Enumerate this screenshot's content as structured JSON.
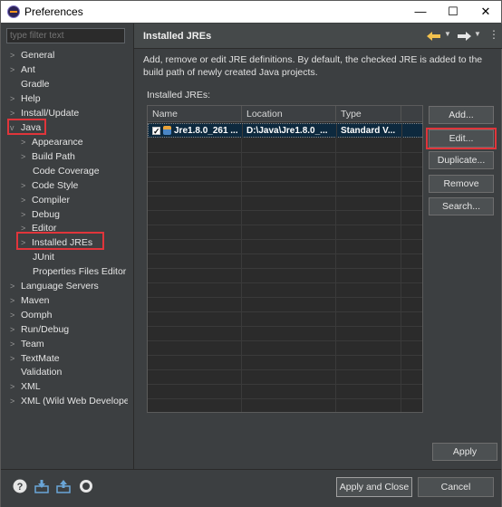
{
  "window": {
    "title": "Preferences",
    "minimize": "—",
    "maximize": "☐",
    "close": "✕"
  },
  "filter": {
    "placeholder": "type filter text"
  },
  "tree": {
    "general": "General",
    "ant": "Ant",
    "gradle": "Gradle",
    "help": "Help",
    "install_update": "Install/Update",
    "java": "Java",
    "appearance": "Appearance",
    "build_path": "Build Path",
    "code_coverage": "Code Coverage",
    "code_style": "Code Style",
    "compiler": "Compiler",
    "debug": "Debug",
    "editor": "Editor",
    "installed_jres": "Installed JREs",
    "junit": "JUnit",
    "properties_files_editor": "Properties Files Editor",
    "language_servers": "Language Servers",
    "maven": "Maven",
    "oomph": "Oomph",
    "run_debug": "Run/Debug",
    "team": "Team",
    "textmate": "TextMate",
    "validation": "Validation",
    "xml": "XML",
    "xml_wild": "XML (Wild Web Develope"
  },
  "page": {
    "title": "Installed JREs",
    "description": "Add, remove or edit JRE definitions. By default, the checked JRE is added to the build path of newly created Java projects.",
    "jres_label": "Installed JREs:"
  },
  "table": {
    "columns": {
      "name": "Name",
      "location": "Location",
      "type": "Type"
    },
    "rows": [
      {
        "checked": true,
        "name": "Jre1.8.0_261 ...",
        "location": "D:\\Java\\Jre1.8.0_...",
        "type": "Standard V..."
      }
    ]
  },
  "buttons": {
    "add": "Add...",
    "edit": "Edit...",
    "duplicate": "Duplicate...",
    "remove": "Remove",
    "search": "Search...",
    "apply": "Apply",
    "apply_and_close": "Apply and Close",
    "cancel": "Cancel"
  },
  "colors": {
    "highlight_box": "#e0353b",
    "background": "#3c3f41",
    "selection": "#0d293e"
  },
  "icons": {
    "back": "back-arrow-icon",
    "forward": "forward-arrow-icon",
    "menu": "view-menu-icon",
    "help": "help-icon",
    "import": "import-icon",
    "export": "export-icon",
    "record": "record-icon"
  }
}
